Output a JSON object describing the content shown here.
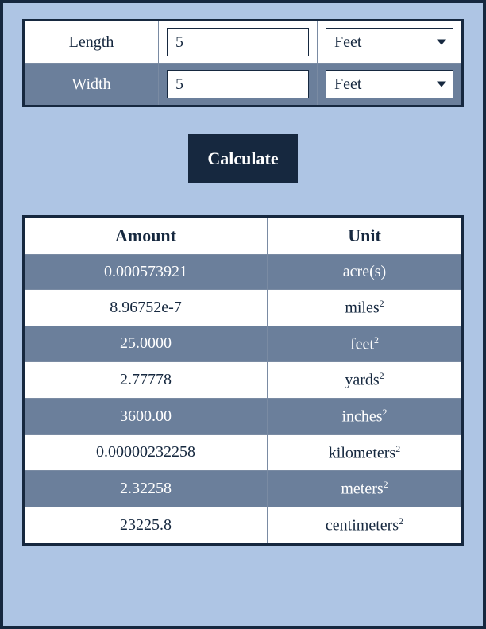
{
  "inputs": {
    "length": {
      "label": "Length",
      "value": "5",
      "unit_selected": "Feet"
    },
    "width": {
      "label": "Width",
      "value": "5",
      "unit_selected": "Feet"
    }
  },
  "calculate_label": "Calculate",
  "results": {
    "headers": {
      "amount": "Amount",
      "unit": "Unit"
    },
    "rows": [
      {
        "amount": "0.000573921",
        "unit_base": "acre(s)",
        "squared": false
      },
      {
        "amount": "8.96752e-7",
        "unit_base": "miles",
        "squared": true
      },
      {
        "amount": "25.0000",
        "unit_base": "feet",
        "squared": true
      },
      {
        "amount": "2.77778",
        "unit_base": "yards",
        "squared": true
      },
      {
        "amount": "3600.00",
        "unit_base": "inches",
        "squared": true
      },
      {
        "amount": "0.00000232258",
        "unit_base": "kilometers",
        "squared": true
      },
      {
        "amount": "2.32258",
        "unit_base": "meters",
        "squared": true
      },
      {
        "amount": "23225.8",
        "unit_base": "centimeters",
        "squared": true
      }
    ]
  }
}
